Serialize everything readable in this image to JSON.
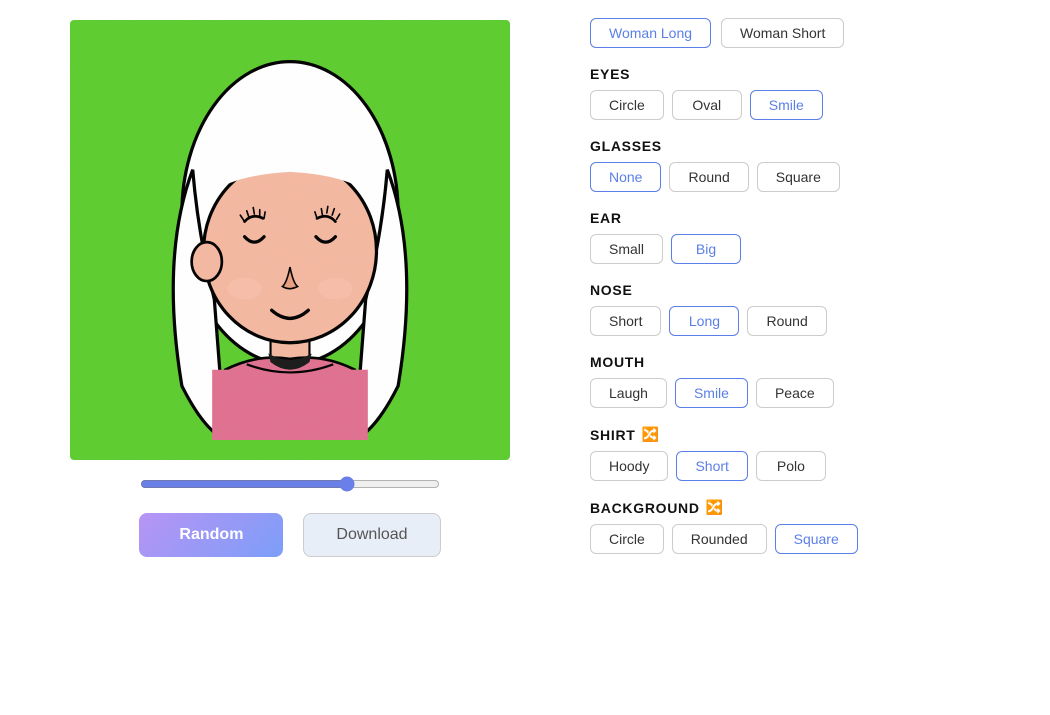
{
  "left": {
    "random_label": "Random",
    "download_label": "Download",
    "slider_value": 70
  },
  "right": {
    "hair": {
      "options": [
        {
          "id": "woman-long",
          "label": "Woman Long",
          "active": true
        },
        {
          "id": "woman-short",
          "label": "Woman Short",
          "active": false
        }
      ]
    },
    "eyes": {
      "label": "EYES",
      "options": [
        {
          "id": "circle",
          "label": "Circle",
          "active": false
        },
        {
          "id": "oval",
          "label": "Oval",
          "active": false
        },
        {
          "id": "smile",
          "label": "Smile",
          "active": true
        }
      ]
    },
    "glasses": {
      "label": "GLASSES",
      "options": [
        {
          "id": "none",
          "label": "None",
          "active": true
        },
        {
          "id": "round",
          "label": "Round",
          "active": false
        },
        {
          "id": "square",
          "label": "Square",
          "active": false
        }
      ]
    },
    "ear": {
      "label": "EAR",
      "options": [
        {
          "id": "small",
          "label": "Small",
          "active": false
        },
        {
          "id": "big",
          "label": "Big",
          "active": true
        }
      ]
    },
    "nose": {
      "label": "NOSE",
      "options": [
        {
          "id": "short",
          "label": "Short",
          "active": false
        },
        {
          "id": "long",
          "label": "Long",
          "active": true
        },
        {
          "id": "round",
          "label": "Round",
          "active": false
        }
      ]
    },
    "mouth": {
      "label": "MOUTH",
      "options": [
        {
          "id": "laugh",
          "label": "Laugh",
          "active": false
        },
        {
          "id": "smile",
          "label": "Smile",
          "active": true
        },
        {
          "id": "peace",
          "label": "Peace",
          "active": false
        }
      ]
    },
    "shirt": {
      "label": "SHIRT",
      "icon": "🔀",
      "options": [
        {
          "id": "hoody",
          "label": "Hoody",
          "active": false
        },
        {
          "id": "short",
          "label": "Short",
          "active": true
        },
        {
          "id": "polo",
          "label": "Polo",
          "active": false
        }
      ]
    },
    "background": {
      "label": "BACKGROUND",
      "icon": "🔀",
      "options": [
        {
          "id": "circle",
          "label": "Circle",
          "active": false
        },
        {
          "id": "rounded",
          "label": "Rounded",
          "active": false
        },
        {
          "id": "square",
          "label": "Square",
          "active": true
        }
      ]
    }
  }
}
